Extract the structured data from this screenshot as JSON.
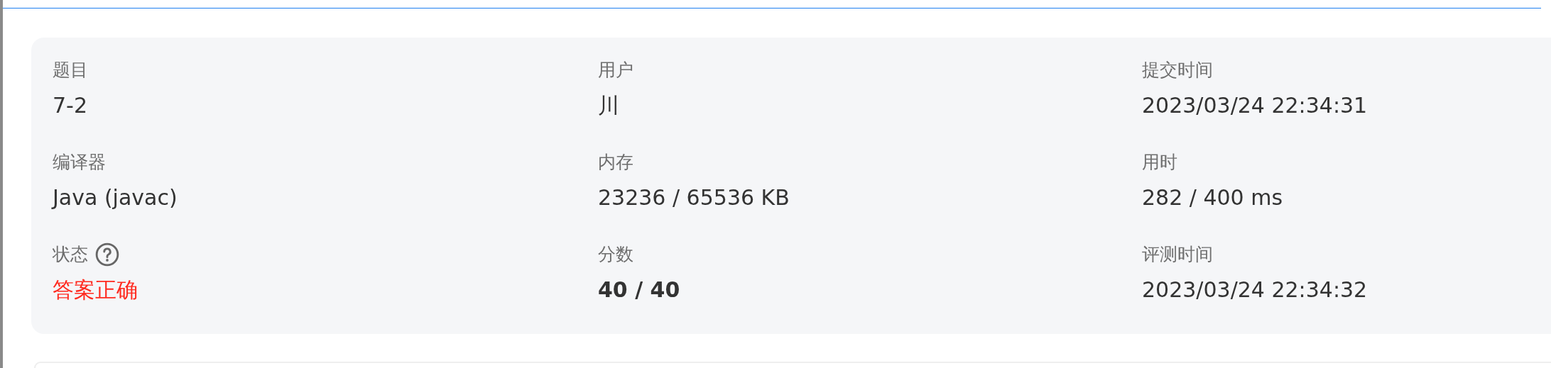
{
  "submission": {
    "fields": [
      {
        "label": "题目",
        "value": "7-2",
        "kind": "plain",
        "help_icon": false
      },
      {
        "label": "用户",
        "value": "川",
        "kind": "plain",
        "help_icon": false
      },
      {
        "label": "提交时间",
        "value": "2023/03/24 22:34:31",
        "kind": "plain",
        "help_icon": false
      },
      {
        "label": "编译器",
        "value": "Java (javac)",
        "kind": "plain",
        "help_icon": false
      },
      {
        "label": "内存",
        "value": "23236 / 65536 KB",
        "kind": "plain",
        "help_icon": false
      },
      {
        "label": "用时",
        "value": "282 / 400 ms",
        "kind": "plain",
        "help_icon": false
      },
      {
        "label": "状态",
        "value": "答案正确",
        "kind": "status",
        "help_icon": true
      },
      {
        "label": "分数",
        "value": "40 / 40",
        "kind": "score",
        "help_icon": false
      },
      {
        "label": "评测时间",
        "value": "2023/03/24 22:34:32",
        "kind": "plain",
        "help_icon": false
      }
    ]
  }
}
